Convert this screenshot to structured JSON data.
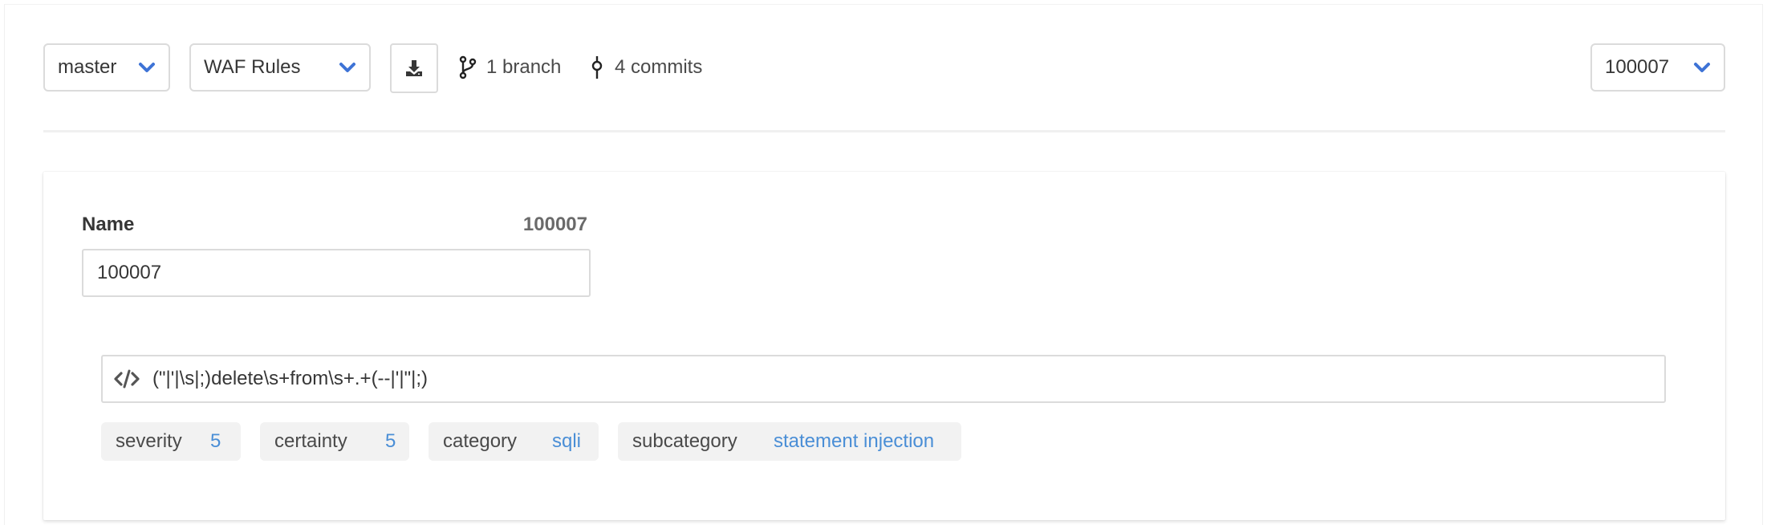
{
  "toolbar": {
    "branch_select": {
      "value": "master"
    },
    "doc_select": {
      "value": "WAF Rules"
    },
    "download_button": {
      "icon": "download-icon"
    },
    "branches": {
      "icon": "git-branch-icon",
      "text": "1 branch"
    },
    "commits": {
      "icon": "git-commit-icon",
      "text": "4 commits"
    },
    "entry_select": {
      "value": "100007"
    }
  },
  "card": {
    "name_label": "Name",
    "entry_id": "100007",
    "name_value": "100007",
    "regex": {
      "icon": "code-icon",
      "value": "(\"|'|\\s|;)delete\\s+from\\s+.+(--|'|\"|;)"
    },
    "tags": [
      {
        "key": "severity",
        "value": "5"
      },
      {
        "key": "certainty",
        "value": "5"
      },
      {
        "key": "category",
        "value": "sqli"
      },
      {
        "key": "subcategory",
        "value": "statement injection"
      }
    ]
  },
  "colors": {
    "accent": "#3e73d6",
    "tag_value": "#4a8ed6",
    "border": "#dbdbdb",
    "tag_bg": "#f2f2f2"
  }
}
